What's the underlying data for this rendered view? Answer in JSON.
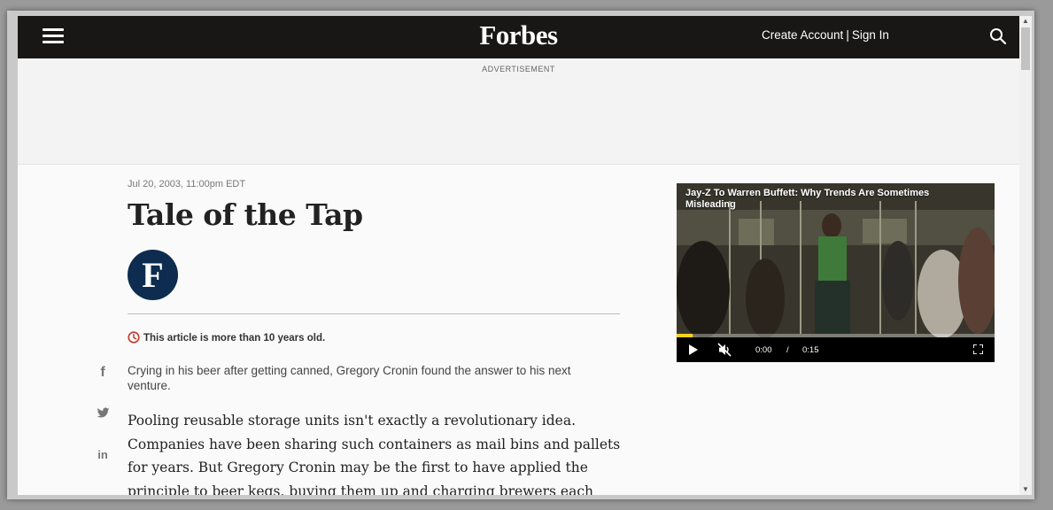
{
  "header": {
    "logo": "Forbes",
    "create_account": "Create Account",
    "separator": "|",
    "sign_in": "Sign In",
    "bg_color": "#181716"
  },
  "ad": {
    "label": "ADVERTISEMENT"
  },
  "article": {
    "timestamp": "Jul 20, 2003, 11:00pm EDT",
    "headline": "Tale of the Tap",
    "author_initial": "F",
    "old_notice": "This article is more than 10 years old.",
    "dek": "Crying in his beer after getting canned, Gregory Cronin found the answer to his next venture.",
    "body": "Pooling reusable storage units isn't exactly a revolutionary idea. Companies have been sharing such containers as mail bins and pallets for years. But Gregory Cronin may be the first to have applied the principle to beer kegs, buying them up and charging brewers each time they fill and ship them. It's"
  },
  "social": {
    "facebook_glyph": "f",
    "linkedin_glyph": "in",
    "icons": [
      "facebook-icon",
      "twitter-icon",
      "linkedin-icon"
    ]
  },
  "video": {
    "title": "Jay-Z To Warren Buffett: Why Trends Are Sometimes Misleading",
    "current_time": "0:00",
    "time_separator": "/",
    "duration": "0:15",
    "progress_fraction": 0.05,
    "progress_color": "#f4d21f"
  },
  "colors": {
    "accent_red": "#c0392b",
    "avatar_navy": "#0d2c4f"
  }
}
